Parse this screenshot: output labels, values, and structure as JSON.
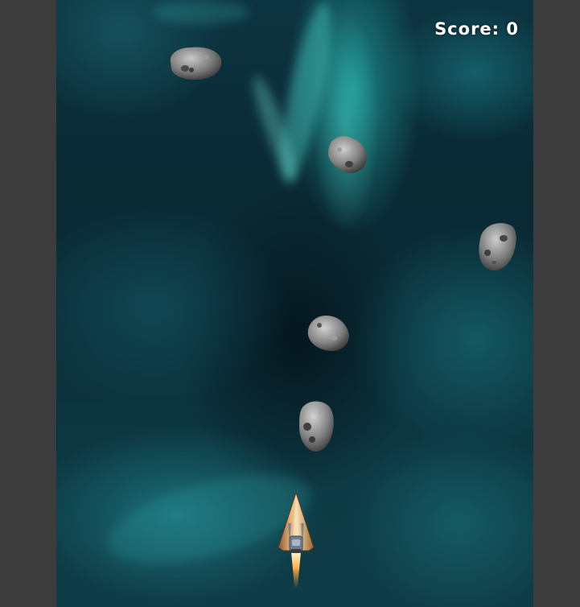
{
  "hud": {
    "score_label": "Score:",
    "score_value": "0"
  },
  "colors": {
    "page_background": "#3c3c3c",
    "space_dark": "#0a2a34",
    "nebula_teal": "#28d2c8",
    "asteroid_gray": "#8a8a8a",
    "ship_orange": "#d9a066"
  },
  "entities": {
    "player": "spaceship-icon",
    "hazard": "asteroid-icon"
  }
}
